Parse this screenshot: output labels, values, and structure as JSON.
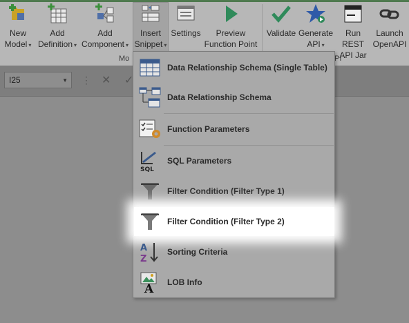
{
  "ribbon": {
    "buttons": [
      {
        "line1": "New",
        "line2": "Model"
      },
      {
        "line1": "Add",
        "line2": "Definition"
      },
      {
        "line1": "Add",
        "line2": "Component"
      },
      {
        "line1": "Insert",
        "line2": "Snippet"
      },
      {
        "line1": "Settings",
        "line2": ""
      },
      {
        "line1": "Preview",
        "line2": "Function Point"
      },
      {
        "line1": "Validate",
        "line2": ""
      },
      {
        "line1": "Generate",
        "line2": "API"
      },
      {
        "line1": "Run REST",
        "line2": "API Jar"
      },
      {
        "line1": "Launch",
        "line2": "OpenAPI"
      }
    ],
    "group_label_left": "Mo",
    "group_label_right": "PI",
    "caret": "▾"
  },
  "formula_bar": {
    "name_box": "I25",
    "dots": "⋮",
    "cancel": "✕",
    "enter": "✓"
  },
  "menu": {
    "items": [
      {
        "label": "Data Relationship Schema (Single Table)",
        "icon": "table-icon"
      },
      {
        "label": "Data Relationship Schema",
        "icon": "schema-icon"
      },
      {
        "label": "Function Parameters",
        "icon": "function-params-icon"
      },
      {
        "label": "SQL Parameters",
        "icon": "sql-icon"
      },
      {
        "label": "Filter Condition (Filter Type 1)",
        "icon": "filter-icon"
      },
      {
        "label": "Filter Condition (Filter Type 2)",
        "icon": "filter-icon"
      },
      {
        "label": "Sorting Criteria",
        "icon": "sort-az-icon"
      },
      {
        "label": "LOB Info",
        "icon": "lob-icon"
      }
    ],
    "highlighted_index": 5
  },
  "colors": {
    "ribbon_bg": "#b7b7b7",
    "sheet_bg": "#8d8d8d",
    "menu_bg": "#a9a9a9",
    "highlight": "#ffffff",
    "accent_green": "#2f8a5a",
    "accent_blue": "#2f5aa8"
  }
}
